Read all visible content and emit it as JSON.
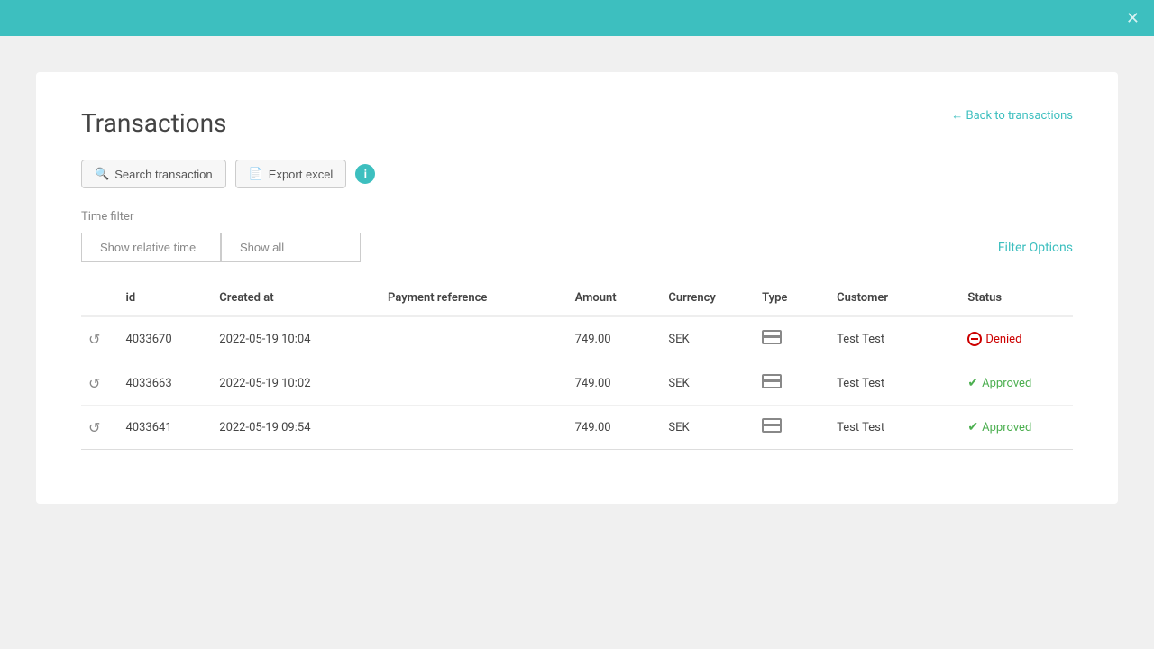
{
  "topbar": {
    "close_label": "✕"
  },
  "page": {
    "title": "Transactions",
    "back_link": "← Back to transactions"
  },
  "toolbar": {
    "search_label": "Search transaction",
    "export_label": "Export excel",
    "info_icon": "i"
  },
  "time_filter": {
    "label": "Time filter",
    "show_relative_time": "Show relative time",
    "show_all": "Show all",
    "filter_options_label": "Filter Options"
  },
  "table": {
    "columns": [
      "",
      "id",
      "Created at",
      "Payment reference",
      "Amount",
      "Currency",
      "Type",
      "Customer",
      "Status"
    ],
    "rows": [
      {
        "id": "4033670",
        "created_at": "2022-05-19 10:04",
        "payment_reference": "",
        "amount": "749.00",
        "currency": "SEK",
        "customer": "Test Test",
        "status": "Denied",
        "status_type": "denied"
      },
      {
        "id": "4033663",
        "created_at": "2022-05-19 10:02",
        "payment_reference": "",
        "amount": "749.00",
        "currency": "SEK",
        "customer": "Test Test",
        "status": "Approved",
        "status_type": "approved"
      },
      {
        "id": "4033641",
        "created_at": "2022-05-19 09:54",
        "payment_reference": "",
        "amount": "749.00",
        "currency": "SEK",
        "customer": "Test Test",
        "status": "Approved",
        "status_type": "approved"
      }
    ]
  },
  "colors": {
    "teal": "#3dbfbf",
    "denied_red": "#cc0000",
    "approved_green": "#4caf50"
  }
}
